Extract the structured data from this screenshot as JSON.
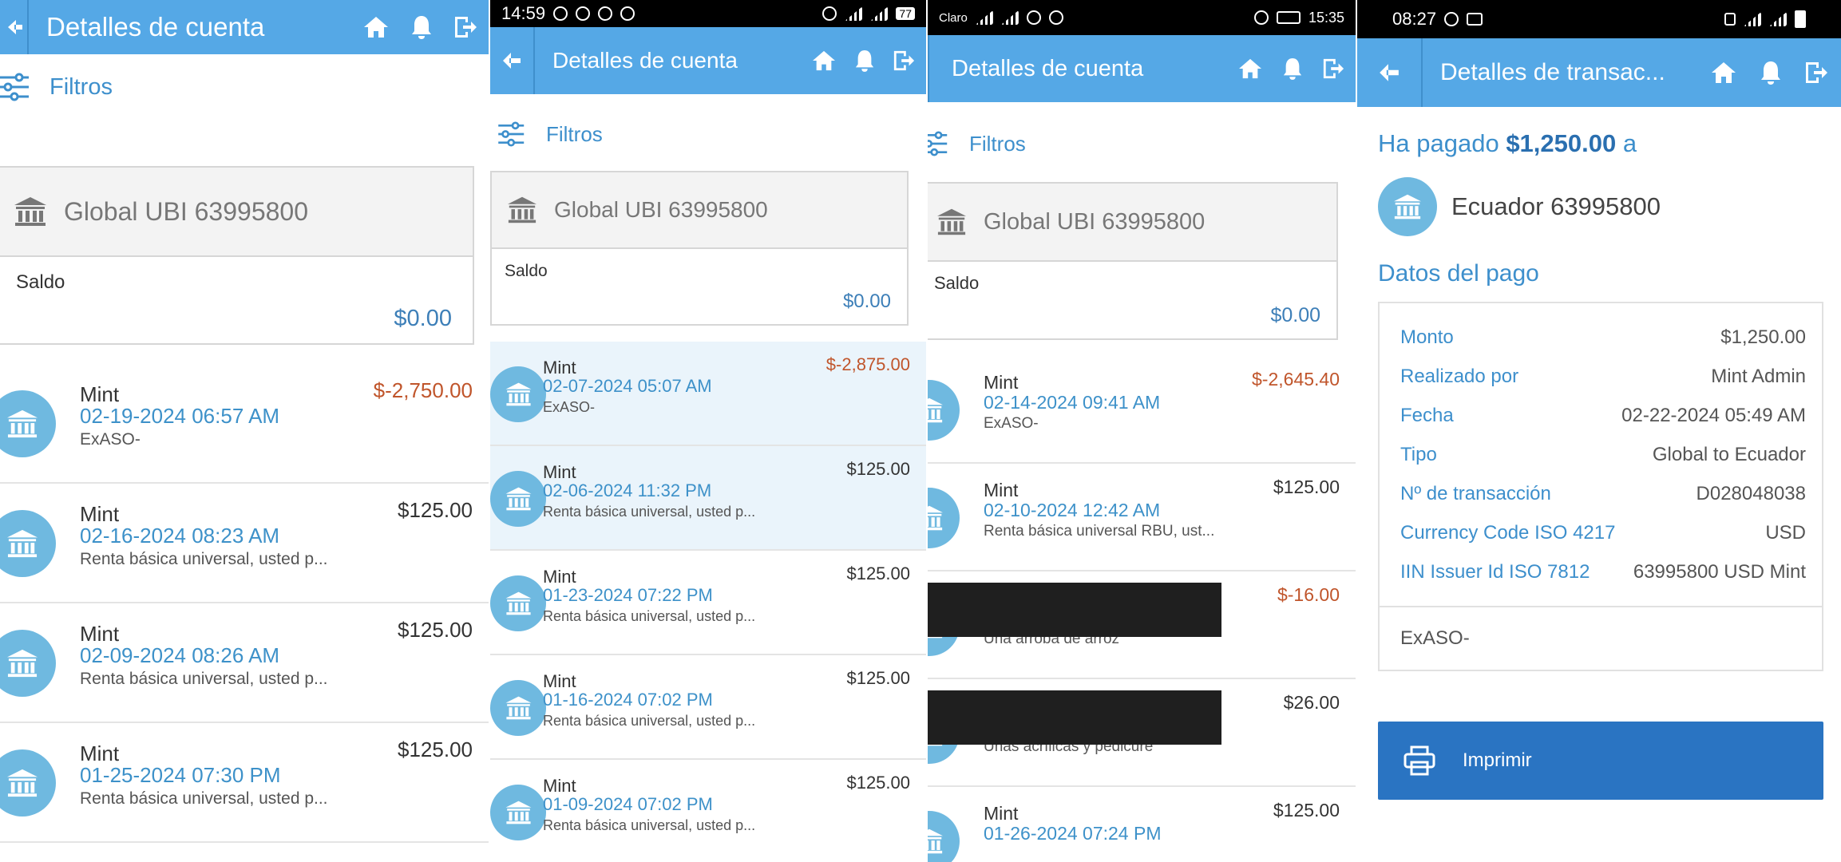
{
  "panels": [
    {
      "title": "Detalles de cuenta",
      "filters_label": "Filtros",
      "account_name": "Global UBI 63995800",
      "balance_label": "Saldo",
      "balance_value": "$0.00",
      "transactions": [
        {
          "name": "Mint",
          "date": "02-19-2024 06:57 AM",
          "memo": "ExASO-",
          "amount": "$-2,750.00",
          "negative": true
        },
        {
          "name": "Mint",
          "date": "02-16-2024 08:23 AM",
          "memo": "Renta básica universal, usted p...",
          "amount": "$125.00",
          "negative": false
        },
        {
          "name": "Mint",
          "date": "02-09-2024 08:26 AM",
          "memo": "Renta básica universal, usted p...",
          "amount": "$125.00",
          "negative": false
        },
        {
          "name": "Mint",
          "date": "01-25-2024 07:30 PM",
          "memo": "Renta básica universal, usted p...",
          "amount": "$125.00",
          "negative": false
        }
      ]
    },
    {
      "status_time": "14:59",
      "status_battery": "77",
      "title": "Detalles de cuenta",
      "filters_label": "Filtros",
      "account_name": "Global UBI 63995800",
      "balance_label": "Saldo",
      "balance_value": "$0.00",
      "transactions": [
        {
          "name": "Mint",
          "date": "02-07-2024 05:07 AM",
          "memo": "ExASO-",
          "amount": "$-2,875.00",
          "negative": true,
          "highlight": true
        },
        {
          "name": "Mint",
          "date": "02-06-2024 11:32 PM",
          "memo": "Renta básica universal, usted p...",
          "amount": "$125.00",
          "negative": false,
          "highlight": true
        },
        {
          "name": "Mint",
          "date": "01-23-2024 07:22 PM",
          "memo": "Renta básica universal, usted p...",
          "amount": "$125.00",
          "negative": false
        },
        {
          "name": "Mint",
          "date": "01-16-2024 07:02 PM",
          "memo": "Renta básica universal, usted p...",
          "amount": "$125.00",
          "negative": false
        },
        {
          "name": "Mint",
          "date": "01-09-2024 07:02 PM",
          "memo": "Renta básica universal, usted p...",
          "amount": "$125.00",
          "negative": false
        }
      ]
    },
    {
      "status_carrier": "Claro",
      "status_time": "15:35",
      "title": "Detalles de cuenta",
      "filters_label": "Filtros",
      "account_name": "Global UBI 63995800",
      "balance_label": "Saldo",
      "balance_value": "$0.00",
      "transactions": [
        {
          "name": "Mint",
          "date": "02-14-2024 09:41 AM",
          "memo": "ExASO-",
          "amount": "$-2,645.40",
          "negative": true
        },
        {
          "name": "Mint",
          "date": "02-10-2024 12:42 AM",
          "memo": "Renta básica universal RBU, ust...",
          "amount": "$125.00",
          "negative": false
        },
        {
          "name": "",
          "date": "",
          "memo": "Una arroba de arroz",
          "amount": "$-16.00",
          "negative": true,
          "redacted": true
        },
        {
          "name": "",
          "date": "",
          "memo": "Uñas acrílicas y pedicure",
          "amount": "$26.00",
          "negative": false,
          "redacted": true
        },
        {
          "name": "Mint",
          "date": "01-26-2024 07:24 PM",
          "memo": "",
          "amount": "$125.00",
          "negative": false
        }
      ]
    },
    {
      "status_time": "08:27",
      "title": "Detalles de transac...",
      "paid_prefix": "Ha pagado",
      "paid_amount": "$1,250.00",
      "paid_suffix": "a",
      "recipient": "Ecuador 63995800",
      "section_title": "Datos del pago",
      "details": [
        {
          "label": "Monto",
          "value": "$1,250.00"
        },
        {
          "label": "Realizado por",
          "value": "Mint Admin"
        },
        {
          "label": "Fecha",
          "value": "02-22-2024 05:49 AM"
        },
        {
          "label": "Tipo",
          "value": "Global to Ecuador"
        },
        {
          "label": "Nº de transacción",
          "value": "D028048038"
        },
        {
          "label": "Currency Code ISO 4217",
          "value": "USD"
        },
        {
          "label": "IIN Issuer Id ISO 7812",
          "value": "63995800 USD Mint"
        }
      ],
      "note": "ExASO-",
      "print_label": "Imprimir"
    }
  ],
  "colors": {
    "appbar": "#55a8e6",
    "accent": "#3d8fcc",
    "negative": "#c0552b",
    "avatar": "#6fb9e0",
    "button": "#2a74c2"
  }
}
